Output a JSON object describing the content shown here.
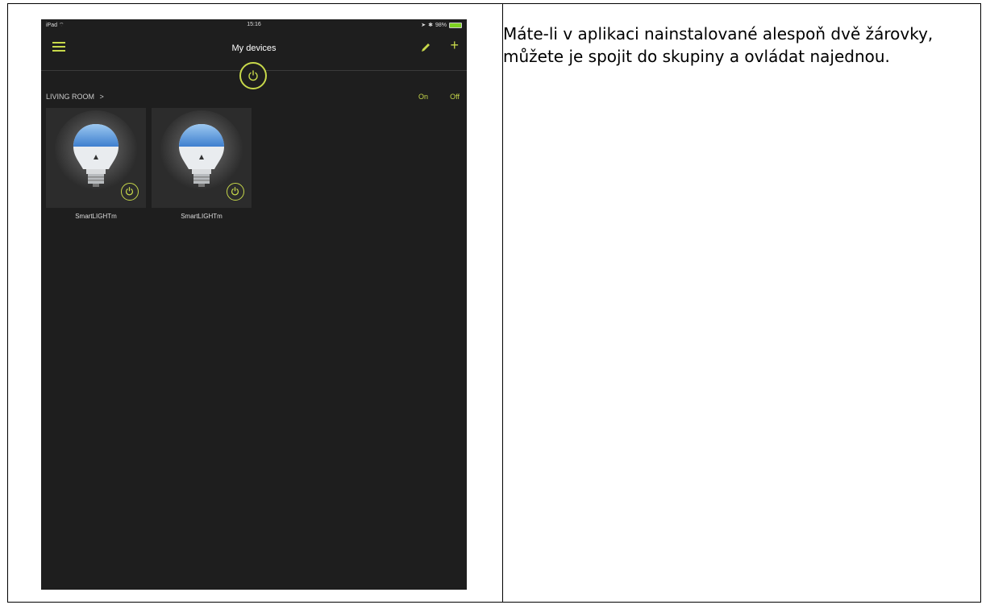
{
  "caption": "Máte-li v aplikaci nainstalované alespoň dvě žárovky, můžete je spojit do skupiny a ovládat najednou.",
  "ipad": {
    "statusbar": {
      "carrier": "iPad",
      "time": "15:16",
      "battery": "98%",
      "battery_level": 0.98
    },
    "navbar": {
      "title": "My devices",
      "menu_icon": "hamburger-menu-icon",
      "edit_icon": "pencil-icon",
      "add_icon": "plus-icon",
      "add_glyph": "+"
    },
    "group": {
      "name": "LIVING ROOM",
      "chevron": ">",
      "on_label": "On",
      "off_label": "Off"
    },
    "devices": [
      {
        "name": "SmartLIGHTm",
        "icon": "bulb-icon"
      },
      {
        "name": "SmartLIGHTm",
        "icon": "bulb-icon"
      }
    ],
    "colors": {
      "accent": "#c7d84a",
      "background": "#1e1e1e",
      "tile": "#2c2c2c",
      "bulb_glow": "#6aa7e8"
    }
  }
}
